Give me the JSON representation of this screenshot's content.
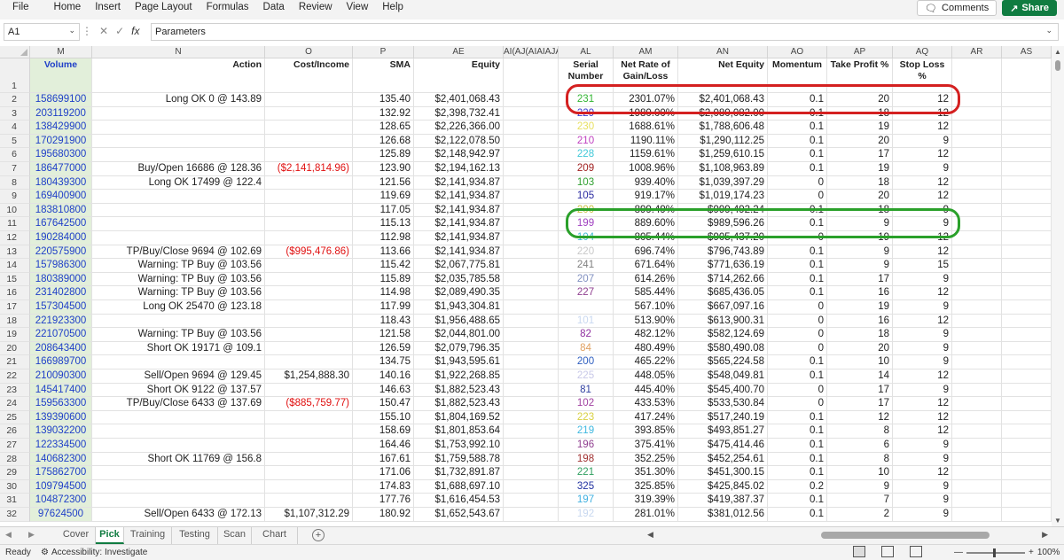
{
  "menu": [
    "File",
    "Home",
    "Insert",
    "Page Layout",
    "Formulas",
    "Data",
    "Review",
    "View",
    "Help"
  ],
  "buttons": {
    "comments": "Comments",
    "share": "Share"
  },
  "namebox": "A1",
  "formula": "Parameters",
  "columns": [
    "M",
    "N",
    "O",
    "P",
    "AE",
    "AI(AJ(AIAIAJAI",
    "AL",
    "AM",
    "AN",
    "AO",
    "AP",
    "AQ",
    "AR",
    "AS"
  ],
  "headers": {
    "volume": "Volume",
    "action": "Action",
    "cost": "Cost/Income",
    "sma": "SMA",
    "equity": "Equity",
    "serial": "Serial Number",
    "net_rate": "Net Rate of Gain/Loss",
    "net_equity": "Net Equity",
    "momentum": "Momentum",
    "take_profit": "Take Profit %",
    "stop_loss": "Stop Loss %"
  },
  "rows": [
    {
      "n": "2",
      "volume": "158699100",
      "action": "Long OK 0 @ 143.89",
      "cost": "",
      "sma": "135.40",
      "equity": "$2,401,068.43",
      "serial": "231",
      "serial_color": "#33b533",
      "rate": "2301.07%",
      "net": "$2,401,068.43",
      "mom": "0.1",
      "tp": "20",
      "sl": "12"
    },
    {
      "n": "3",
      "volume": "203119200",
      "action": "",
      "cost": "",
      "sma": "132.92",
      "equity": "$2,398,732.41",
      "serial": "229",
      "serial_color": "#3a3ad0",
      "rate": "1980.00%",
      "net": "$2,080,082.00",
      "mom": "0.1",
      "tp": "18",
      "sl": "12",
      "strike": true
    },
    {
      "n": "4",
      "volume": "138429900",
      "action": "",
      "cost": "",
      "sma": "128.65",
      "equity": "$2,226,366.00",
      "serial": "230",
      "serial_color": "#e8e060",
      "rate": "1688.61%",
      "net": "$1,788,606.48",
      "mom": "0.1",
      "tp": "19",
      "sl": "12"
    },
    {
      "n": "5",
      "volume": "170291900",
      "action": "",
      "cost": "",
      "sma": "126.68",
      "equity": "$2,122,078.50",
      "serial": "210",
      "serial_color": "#c040c0",
      "rate": "1190.11%",
      "net": "$1,290,112.25",
      "mom": "0.1",
      "tp": "20",
      "sl": "9"
    },
    {
      "n": "6",
      "volume": "195680300",
      "action": "",
      "cost": "",
      "sma": "125.89",
      "equity": "$2,148,942.97",
      "serial": "228",
      "serial_color": "#40c8d8",
      "rate": "1159.61%",
      "net": "$1,259,610.15",
      "mom": "0.1",
      "tp": "17",
      "sl": "12"
    },
    {
      "n": "7",
      "volume": "186477000",
      "action": "Buy/Open 16686 @ 128.36",
      "cost": "($2,141,814.96)",
      "sma": "123.90",
      "equity": "$2,194,162.13",
      "serial": "209",
      "serial_color": "#a02020",
      "rate": "1008.96%",
      "net": "$1,108,963.89",
      "mom": "0.1",
      "tp": "19",
      "sl": "9"
    },
    {
      "n": "8",
      "volume": "180439300",
      "action": "Long OK 17499 @ 122.4",
      "cost": "",
      "sma": "121.56",
      "equity": "$2,141,934.87",
      "serial": "103",
      "serial_color": "#30a030",
      "rate": "939.40%",
      "net": "$1,039,397.29",
      "mom": "0",
      "tp": "18",
      "sl": "12"
    },
    {
      "n": "9",
      "volume": "169400900",
      "action": "",
      "cost": "",
      "sma": "119.69",
      "equity": "$2,141,934.87",
      "serial": "105",
      "serial_color": "#2a2aa0",
      "rate": "919.17%",
      "net": "$1,019,174.23",
      "mom": "0",
      "tp": "20",
      "sl": "12"
    },
    {
      "n": "10",
      "volume": "183810800",
      "action": "",
      "cost": "",
      "sma": "117.05",
      "equity": "$2,141,934.87",
      "serial": "200",
      "serial_color": "#c8c040",
      "rate": "899.49%",
      "net": "$999,492.24",
      "mom": "0.1",
      "tp": "18",
      "sl": "9",
      "strike": true
    },
    {
      "n": "11",
      "volume": "167642500",
      "action": "",
      "cost": "",
      "sma": "115.13",
      "equity": "$2,141,934.87",
      "serial": "199",
      "serial_color": "#a040c0",
      "rate": "889.60%",
      "net": "$989,596.26",
      "mom": "0.1",
      "tp": "9",
      "sl": "9"
    },
    {
      "n": "12",
      "volume": "190284000",
      "action": "",
      "cost": "",
      "sma": "112.98",
      "equity": "$2,141,934.87",
      "serial": "104",
      "serial_color": "#40b8d0",
      "rate": "805.44%",
      "net": "$905,437.20",
      "mom": "0",
      "tp": "19",
      "sl": "12",
      "strike": true
    },
    {
      "n": "13",
      "volume": "220575900",
      "action": "TP/Buy/Close 9694 @ 102.69",
      "cost": "($995,476.86)",
      "sma": "113.66",
      "equity": "$2,141,934.87",
      "serial": "220",
      "serial_color": "#c8c8c8",
      "rate": "696.74%",
      "net": "$796,743.89",
      "mom": "0.1",
      "tp": "9",
      "sl": "12"
    },
    {
      "n": "14",
      "volume": "157986300",
      "action": "Warning: TP Buy @ 103.56",
      "cost": "",
      "sma": "115.42",
      "equity": "$2,067,775.81",
      "serial": "241",
      "serial_color": "#808080",
      "rate": "671.64%",
      "net": "$771,636.19",
      "mom": "0.1",
      "tp": "9",
      "sl": "15"
    },
    {
      "n": "15",
      "volume": "180389000",
      "action": "Warning: TP Buy @ 103.56",
      "cost": "",
      "sma": "115.89",
      "equity": "$2,035,785.58",
      "serial": "207",
      "serial_color": "#8090c0",
      "rate": "614.26%",
      "net": "$714,262.66",
      "mom": "0.1",
      "tp": "17",
      "sl": "9"
    },
    {
      "n": "16",
      "volume": "231402800",
      "action": "Warning: TP Buy @ 103.56",
      "cost": "",
      "sma": "114.98",
      "equity": "$2,089,490.35",
      "serial": "227",
      "serial_color": "#904090",
      "rate": "585.44%",
      "net": "$685,436.05",
      "mom": "0.1",
      "tp": "16",
      "sl": "12"
    },
    {
      "n": "17",
      "volume": "157304500",
      "action": "Long OK 25470 @ 123.18",
      "cost": "",
      "sma": "117.99",
      "equity": "$1,943,304.81",
      "serial": "",
      "serial_color": "#f0f0a0",
      "rate": "567.10%",
      "net": "$667,097.16",
      "mom": "0",
      "tp": "19",
      "sl": "9"
    },
    {
      "n": "18",
      "volume": "221923300",
      "action": "",
      "cost": "",
      "sma": "118.43",
      "equity": "$1,956,488.65",
      "serial": "101",
      "serial_color": "#c8d8f0",
      "rate": "513.90%",
      "net": "$613,900.31",
      "mom": "0",
      "tp": "16",
      "sl": "12"
    },
    {
      "n": "19",
      "volume": "221070500",
      "action": "Warning: TP Buy @ 103.56",
      "cost": "",
      "sma": "121.58",
      "equity": "$2,044,801.00",
      "serial": "82",
      "serial_color": "#9030a0",
      "rate": "482.12%",
      "net": "$582,124.69",
      "mom": "0",
      "tp": "18",
      "sl": "9"
    },
    {
      "n": "20",
      "volume": "208643400",
      "action": "Short OK 19171 @ 109.1",
      "cost": "",
      "sma": "126.59",
      "equity": "$2,079,796.35",
      "serial": "84",
      "serial_color": "#e0a060",
      "rate": "480.49%",
      "net": "$580,490.08",
      "mom": "0",
      "tp": "20",
      "sl": "9"
    },
    {
      "n": "21",
      "volume": "166989700",
      "action": "",
      "cost": "",
      "sma": "134.75",
      "equity": "$1,943,595.61",
      "serial": "200",
      "serial_color": "#3060c0",
      "rate": "465.22%",
      "net": "$565,224.58",
      "mom": "0.1",
      "tp": "10",
      "sl": "9"
    },
    {
      "n": "22",
      "volume": "210090300",
      "action": "Sell/Open 9694 @ 129.45",
      "cost": "$1,254,888.30",
      "sma": "140.16",
      "equity": "$1,922,268.85",
      "serial": "225",
      "serial_color": "#c8c8e8",
      "rate": "448.05%",
      "net": "$548,049.81",
      "mom": "0.1",
      "tp": "14",
      "sl": "12"
    },
    {
      "n": "23",
      "volume": "145417400",
      "action": "Short OK 9122 @ 137.57",
      "cost": "",
      "sma": "146.63",
      "equity": "$1,882,523.43",
      "serial": "81",
      "serial_color": "#3040a0",
      "rate": "445.40%",
      "net": "$545,400.70",
      "mom": "0",
      "tp": "17",
      "sl": "9"
    },
    {
      "n": "24",
      "volume": "159563300",
      "action": "TP/Buy/Close 6433 @ 137.69",
      "cost": "($885,759.77)",
      "sma": "150.47",
      "equity": "$1,882,523.43",
      "serial": "102",
      "serial_color": "#a040a0",
      "rate": "433.53%",
      "net": "$533,530.84",
      "mom": "0",
      "tp": "17",
      "sl": "12"
    },
    {
      "n": "25",
      "volume": "139390600",
      "action": "",
      "cost": "",
      "sma": "155.10",
      "equity": "$1,804,169.52",
      "serial": "223",
      "serial_color": "#d8d040",
      "rate": "417.24%",
      "net": "$517,240.19",
      "mom": "0.1",
      "tp": "12",
      "sl": "12"
    },
    {
      "n": "26",
      "volume": "139032200",
      "action": "",
      "cost": "",
      "sma": "158.69",
      "equity": "$1,801,853.64",
      "serial": "219",
      "serial_color": "#40b8e0",
      "rate": "393.85%",
      "net": "$493,851.27",
      "mom": "0.1",
      "tp": "8",
      "sl": "12"
    },
    {
      "n": "27",
      "volume": "122334500",
      "action": "",
      "cost": "",
      "sma": "164.46",
      "equity": "$1,753,992.10",
      "serial": "196",
      "serial_color": "#904090",
      "rate": "375.41%",
      "net": "$475,414.46",
      "mom": "0.1",
      "tp": "6",
      "sl": "9"
    },
    {
      "n": "28",
      "volume": "140682300",
      "action": "Short OK 11769 @ 156.8",
      "cost": "",
      "sma": "167.61",
      "equity": "$1,759,588.78",
      "serial": "198",
      "serial_color": "#a03030",
      "rate": "352.25%",
      "net": "$452,254.61",
      "mom": "0.1",
      "tp": "8",
      "sl": "9"
    },
    {
      "n": "29",
      "volume": "175862700",
      "action": "",
      "cost": "",
      "sma": "171.06",
      "equity": "$1,732,891.87",
      "serial": "221",
      "serial_color": "#30a060",
      "rate": "351.30%",
      "net": "$451,300.15",
      "mom": "0.1",
      "tp": "10",
      "sl": "12"
    },
    {
      "n": "30",
      "volume": "109794500",
      "action": "",
      "cost": "",
      "sma": "174.83",
      "equity": "$1,688,697.10",
      "serial": "325",
      "serial_color": "#2030a0",
      "rate": "325.85%",
      "net": "$425,845.02",
      "mom": "0.2",
      "tp": "9",
      "sl": "9"
    },
    {
      "n": "31",
      "volume": "104872300",
      "action": "",
      "cost": "",
      "sma": "177.76",
      "equity": "$1,616,454.53",
      "serial": "197",
      "serial_color": "#40b0e0",
      "rate": "319.39%",
      "net": "$419,387.37",
      "mom": "0.1",
      "tp": "7",
      "sl": "9"
    },
    {
      "n": "32",
      "volume": "97624500",
      "action": "Sell/Open 6433 @ 172.13",
      "cost": "$1,107,312.29",
      "sma": "180.92",
      "equity": "$1,652,543.67",
      "serial": "192",
      "serial_color": "#c8d8f0",
      "rate": "281.01%",
      "net": "$381,012.56",
      "mom": "0.1",
      "tp": "2",
      "sl": "9"
    }
  ],
  "sheet_tabs": [
    "Cover",
    "Pick",
    "Training",
    "Testing",
    "Scan",
    "Chart"
  ],
  "active_tab": "Pick",
  "status": {
    "ready": "Ready",
    "accessibility": "Accessibility: Investigate",
    "zoom": "100%"
  },
  "colors": {
    "accent": "#107c41",
    "volume_fill": "#e2efda",
    "volume_text": "#1f3fc8",
    "negative": "#e01010",
    "highlight_red": "#d42020",
    "highlight_green": "#2aa02a"
  }
}
